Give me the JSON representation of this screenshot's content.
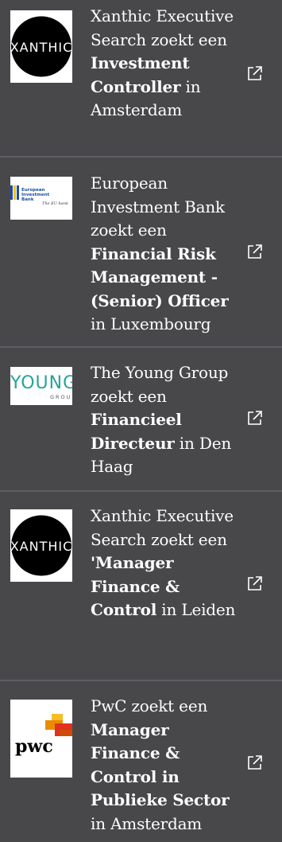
{
  "jobs": [
    {
      "company": "Xanthic Executive Search",
      "connector": "zoekt een",
      "title": "Investment Controller",
      "location_prefix": "in",
      "location": "Amsterdam",
      "logo": "xanthic-logo",
      "logo_text": "XANTHIC",
      "link_icon": "external-link-icon"
    },
    {
      "company": "European Investment Bank",
      "connector": "zoekt een",
      "title": "Financial Risk Management - (Senior) Officer",
      "location_prefix": "in",
      "location": "Luxembourg",
      "logo": "eib-logo",
      "logo_text": "European Investment Bank",
      "logo_tagline": "The EU bank",
      "link_icon": "external-link-icon"
    },
    {
      "company": "The Young Group",
      "connector": "zoekt een",
      "title": "Financieel Directeur",
      "location_prefix": "in",
      "location": "Den Haag",
      "logo": "young-group-logo",
      "logo_text": "YOUNG",
      "logo_subtext": "GROUP",
      "link_icon": "external-link-icon"
    },
    {
      "company": "Xanthic Executive Search",
      "connector": "zoekt een",
      "title": "'Manager Finance & Control",
      "location_prefix": "in",
      "location": "Leiden",
      "logo": "xanthic-logo",
      "logo_text": "XANTHIC",
      "link_icon": "external-link-icon"
    },
    {
      "company": "PwC",
      "connector": "zoekt een",
      "title": "Manager Finance & Control in Publieke Sector",
      "location_prefix": "in",
      "location": "Amsterdam",
      "logo": "pwc-logo",
      "logo_text": "pwc",
      "link_icon": "external-link-icon"
    }
  ],
  "colors": {
    "background": "#48484b",
    "separator": "#5e5e62",
    "text": "#ffffff",
    "young_teal": "#26a39b",
    "eib_blue": "#1c4fa0",
    "eib_yellow": "#f3c300",
    "pwc_orange": "#e0301e",
    "pwc_amber": "#eb8c00"
  }
}
